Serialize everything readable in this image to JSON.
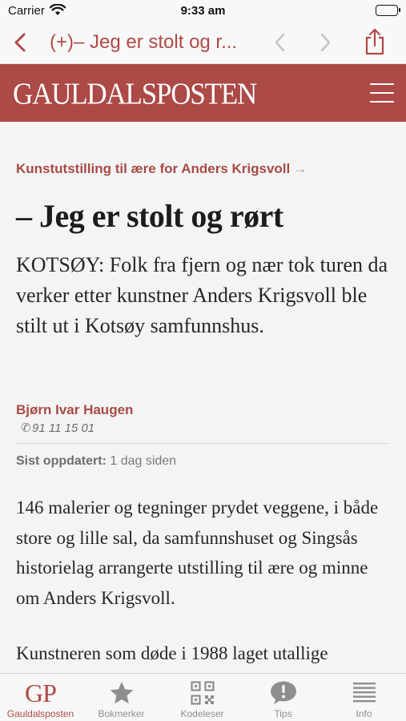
{
  "status_bar": {
    "carrier": "Carrier",
    "time": "9:33 am"
  },
  "nav": {
    "title": "(+)– Jeg er stolt og r..."
  },
  "masthead": {
    "logo": "GAULDALSPOSTEN"
  },
  "article": {
    "kicker": "Kunstutstilling til ære for Anders Krigsvoll",
    "kicker_arrow": "→",
    "headline": "– Jeg er stolt og rørt",
    "lead": "KOTSØY: Folk fra fjern og nær tok turen da verker etter kunstner Anders Krigsvoll ble stilt ut i Kotsøy samfunnshus.",
    "author": "Bjørn Ivar Haugen",
    "phone": "91 11 15 01",
    "updated_label": "Sist oppdatert:",
    "updated_value": "1 dag siden",
    "paragraphs": [
      "146 malerier og tegninger prydet veggene, i både store og lille sal, da samfunnshuset og Singsås historielag arrangerte utstilling til ære og minne om Anders Krigsvoll.",
      "Kunstneren som døde i 1988 laget utallige"
    ]
  },
  "tabs": [
    {
      "label": "Gauldalsposten",
      "icon": "gp-logo-icon",
      "glyph": "GP",
      "active": true
    },
    {
      "label": "Bokmerker",
      "icon": "star-icon"
    },
    {
      "label": "Kodeleser",
      "icon": "qr-code-icon"
    },
    {
      "label": "Tips",
      "icon": "speech-bubble-icon"
    },
    {
      "label": "Info",
      "icon": "list-icon"
    }
  ],
  "colors": {
    "brand": "#ab4a46",
    "accent_text": "#b04a46",
    "inactive": "#8e8e8e"
  }
}
